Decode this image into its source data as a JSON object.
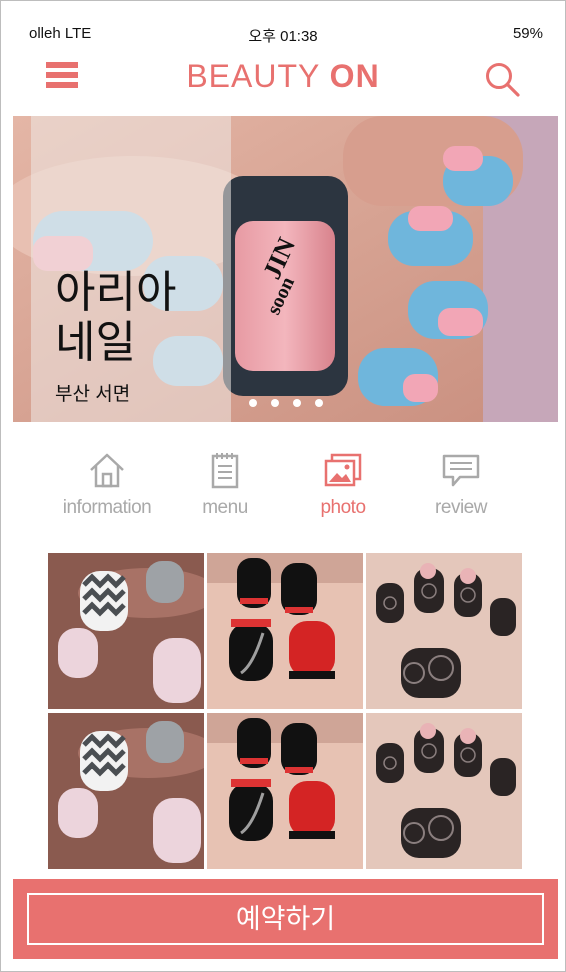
{
  "status_bar": {
    "carrier": "olleh LTE",
    "time": "오후 01:38",
    "battery": "59%"
  },
  "header": {
    "title_light": "BEAUTY",
    "title_bold": "ON",
    "menu_icon": "hamburger-icon",
    "search_icon": "search-icon"
  },
  "hero": {
    "name": "아리아\n네일",
    "location": "부산 서면",
    "slide_count": 4
  },
  "tabs": [
    {
      "label": "information",
      "icon": "home-icon",
      "active": false
    },
    {
      "label": "menu",
      "icon": "notepad-icon",
      "active": false
    },
    {
      "label": "photo",
      "icon": "photo-gallery-icon",
      "active": true
    },
    {
      "label": "review",
      "icon": "chat-bubble-icon",
      "active": false
    }
  ],
  "gallery": [
    {
      "style": "chevron-pink-nails"
    },
    {
      "style": "black-red-french-nails"
    },
    {
      "style": "black-lace-nails"
    },
    {
      "style": "chevron-pink-nails"
    },
    {
      "style": "black-red-french-nails"
    },
    {
      "style": "black-lace-nails"
    }
  ],
  "reserve": {
    "label": "예약하기"
  },
  "colors": {
    "accent": "#e8716f",
    "tab_inactive": "#a9a9a9"
  }
}
